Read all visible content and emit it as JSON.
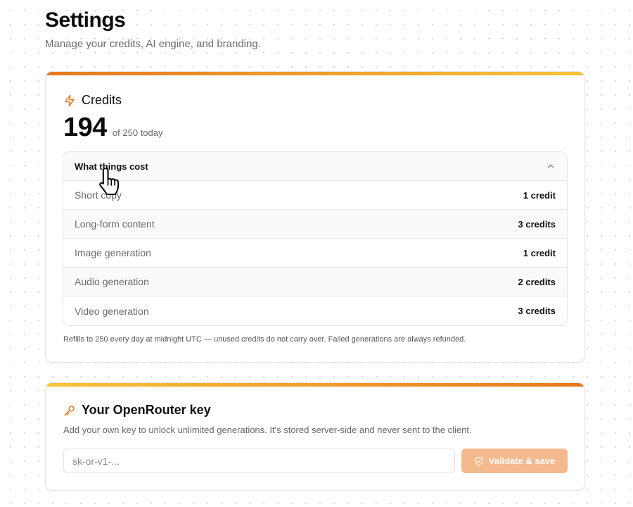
{
  "header": {
    "title": "Settings",
    "subtitle": "Manage your credits, AI engine, and branding."
  },
  "credits": {
    "title": "Credits",
    "icon": "lightning-icon",
    "remaining": "194",
    "of_label": "of 250 today",
    "costs": {
      "title": "What things cost",
      "expanded": true,
      "rows": [
        {
          "name": "Short copy",
          "value": "1 credit"
        },
        {
          "name": "Long-form content",
          "value": "3 credits"
        },
        {
          "name": "Image generation",
          "value": "1 credit"
        },
        {
          "name": "Audio generation",
          "value": "2 credits"
        },
        {
          "name": "Video generation",
          "value": "3 credits"
        }
      ]
    },
    "note": "Refills to 250 every day at midnight UTC — unused credits do not carry over. Failed generations are always refunded."
  },
  "openrouter": {
    "title": "Your OpenRouter key",
    "icon": "key-icon",
    "description": "Add your own key to unlock unlimited generations. It's stored server-side and never sent to the client.",
    "input_value": "",
    "input_placeholder": "sk-or-v1-...",
    "button_label": "Validate & save",
    "button_icon": "shield-check-icon"
  },
  "colors": {
    "accent": "#e6781e",
    "accent_light": "#f7c338",
    "button_disabled": "#f4b98c"
  }
}
